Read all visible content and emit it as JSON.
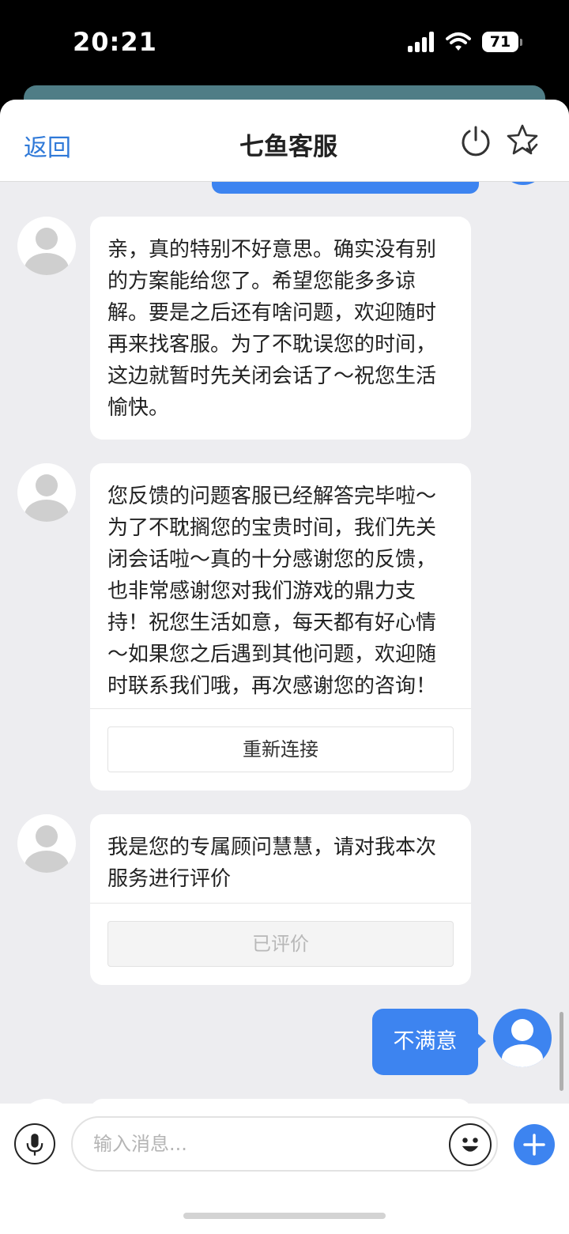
{
  "status_bar": {
    "time": "20:21",
    "battery": "71"
  },
  "header": {
    "back_label": "返回",
    "title": "七鱼客服"
  },
  "messages": [
    {
      "sender": "agent",
      "text": "亲，真的特别不好意思。确实没有别的方案能给您了。希望您能多多谅解。要是之后还有啥问题，欢迎随时再来找客服。为了不耽误您的时间，这边就暂时先关闭会话了～祝您生活愉快。"
    },
    {
      "sender": "agent",
      "text": "您反馈的问题客服已经解答完毕啦～为了不耽搁您的宝贵时间，我们先关闭会话啦～真的十分感谢您的反馈，也非常感谢您对我们游戏的鼎力支持！祝您生活如意，每天都有好心情～如果您之后遇到其他问题，欢迎随时联系我们哦，再次感谢您的咨询！",
      "button": "重新连接"
    },
    {
      "sender": "agent",
      "text": "我是您的专属顾问慧慧，请对我本次服务进行评价",
      "button": "已评价"
    },
    {
      "sender": "user",
      "text": "不满意"
    }
  ],
  "input": {
    "placeholder": "输入消息..."
  },
  "colors": {
    "accent": "#3d84f0",
    "link": "#2f79d8",
    "background": "#ededf0"
  }
}
